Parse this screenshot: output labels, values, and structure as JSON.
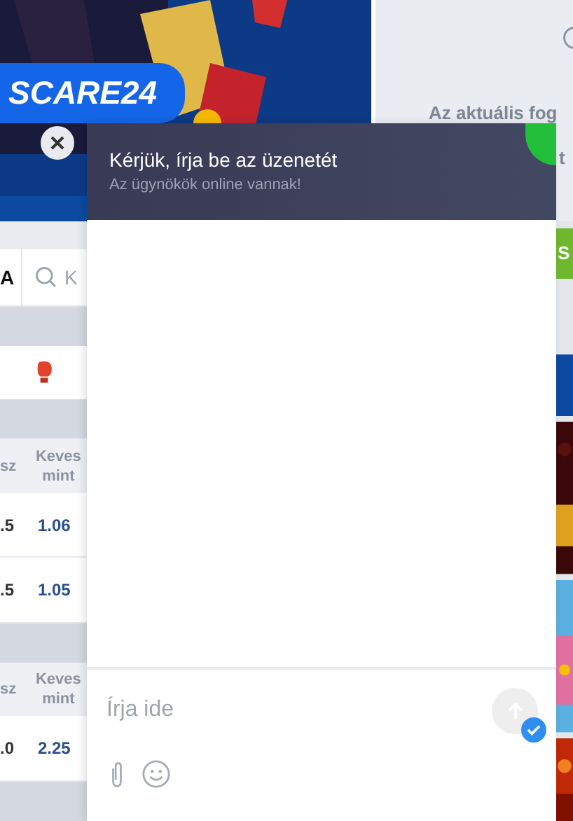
{
  "banner": {
    "promo_code": "SCARE24"
  },
  "info_panel": {
    "lines": [
      "Az aktuális fog",
      "t"
    ]
  },
  "action_button": {
    "label": "S"
  },
  "tabs": [
    {
      "label": "A"
    }
  ],
  "search": {
    "placeholder": "K"
  },
  "odds_tables": [
    {
      "columns": [
        "sz",
        "Keves mint"
      ],
      "rows": [
        [
          ".5",
          "1.06"
        ],
        [
          ".5",
          "1.05"
        ]
      ]
    },
    {
      "columns": [
        "sz",
        "Keves mint"
      ],
      "rows": [
        [
          ".0",
          "2.25"
        ]
      ]
    }
  ],
  "chat": {
    "title": "Kérjük, írja be az üzenetét",
    "status": "Az ügynökök online vannak!",
    "input": {
      "placeholder": "Írja ide"
    }
  }
}
